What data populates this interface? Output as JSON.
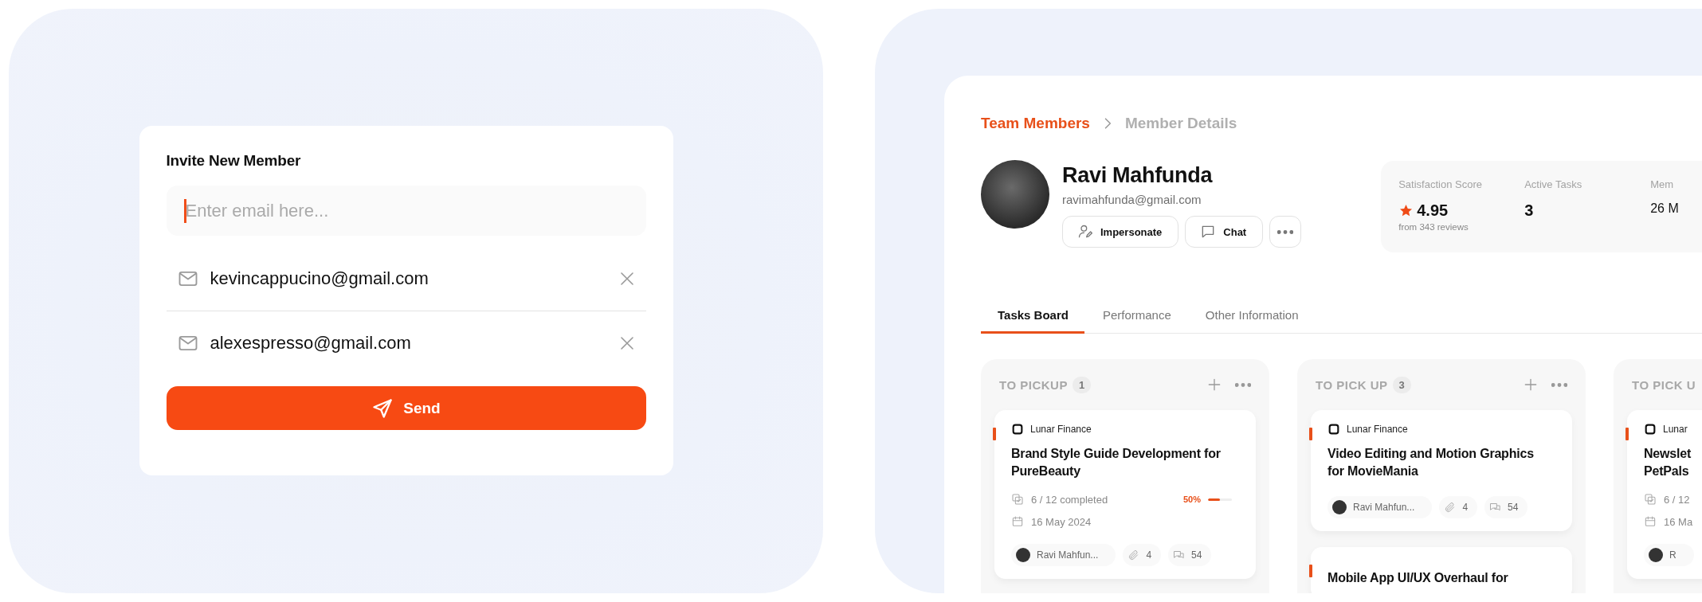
{
  "invite": {
    "title": "Invite New Member",
    "email_input": {
      "placeholder": "Enter email here...",
      "focused": true
    },
    "emails": [
      "kevincappucino@gmail.com",
      "alexespresso@gmail.com"
    ],
    "send_button": "Send"
  },
  "member_details": {
    "breadcrumb": [
      {
        "label": "Team Members",
        "current": false
      },
      {
        "label": "Member Details",
        "current": true
      }
    ],
    "profile": {
      "name": "Ravi Mahfunda",
      "email": "ravimahfunda@gmail.com",
      "actions": [
        {
          "kind": "impersonate",
          "label": "Impersonate"
        },
        {
          "kind": "chat",
          "label": "Chat"
        },
        {
          "kind": "more"
        }
      ]
    },
    "stats": [
      {
        "kind": "rating",
        "label": "Satisfaction Score",
        "value": "4.95",
        "sub": "from 343 reviews"
      },
      {
        "kind": "plain",
        "label": "Active Tasks",
        "value": "3"
      },
      {
        "kind": "plain",
        "label": "Mem",
        "value": "26 M"
      }
    ],
    "tabs": [
      {
        "label": "Tasks Board",
        "selected": true
      },
      {
        "label": "Performance",
        "selected": false
      },
      {
        "label": "Other Information",
        "selected": false
      }
    ],
    "columns": [
      {
        "title": "TO PICKUP",
        "count": "1",
        "cards": [
          {
            "client": "Lunar Finance",
            "title_lines": [
              "Brand Style Guide Development for",
              "PureBeauty"
            ],
            "progress": {
              "text": "6 / 12 completed",
              "percent": "50%",
              "level": 0.5
            },
            "date": "16 May 2024",
            "assignee": "Ravi Mahfun...",
            "attachments": "4",
            "comments": "54"
          }
        ]
      },
      {
        "title": "TO PICK UP",
        "count": "3",
        "cards": [
          {
            "client": "Lunar Finance",
            "title_lines": [
              "Video Editing and Motion Graphics",
              "for MovieMania"
            ],
            "assignee": "Ravi Mahfun...",
            "attachments": "4",
            "comments": "54"
          },
          {
            "title_lines": [
              "Mobile App UI/UX Overhaul for"
            ]
          }
        ]
      },
      {
        "title": "TO PICK U",
        "cards": [
          {
            "client": "Lunar",
            "title_lines": [
              "Newslet",
              "PetPals"
            ],
            "progress": {
              "text": "6 / 12"
            },
            "date": "16 Ma",
            "assignee": "R"
          }
        ]
      }
    ]
  }
}
